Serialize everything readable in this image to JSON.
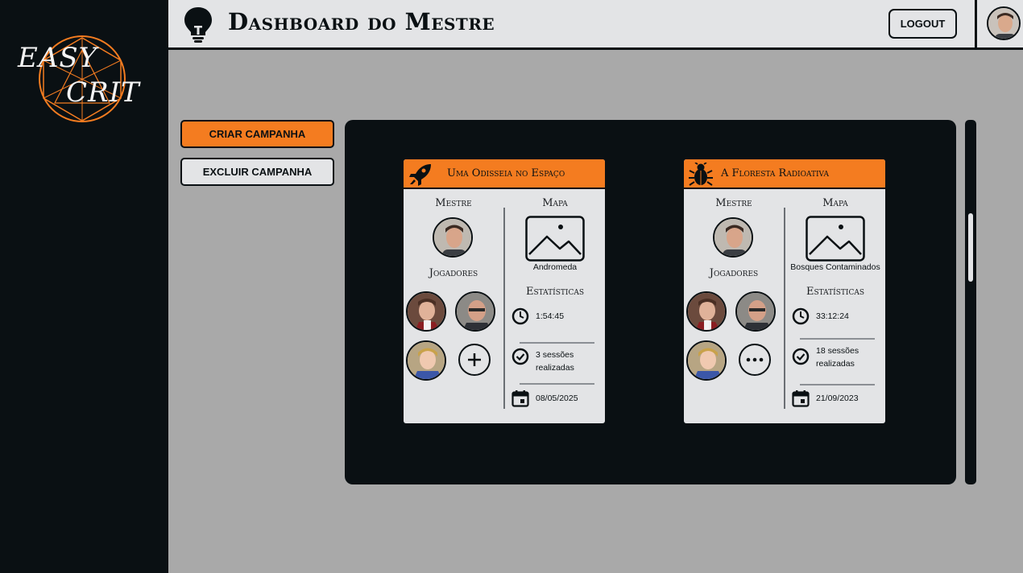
{
  "app": {
    "logo_line1": "EASY",
    "logo_line2": "CRIT",
    "title": "Dashboard do Mestre",
    "logout_label": "LOGOUT"
  },
  "actions": {
    "create_label": "CRIAR CAMPANHA",
    "delete_label": "EXCLUIR CAMPANHA"
  },
  "colors": {
    "accent": "#f47c20",
    "dark": "#0a1013",
    "card_bg": "#e3e4e6",
    "page_bg": "#a9a9a9"
  },
  "campaigns": [
    {
      "icon": "rocket-icon",
      "title": "Uma Odisseia no Espaço",
      "master_label": "Mestre",
      "players_label": "Jogadores",
      "map_label": "Mapa",
      "map_name": "Andromeda",
      "stats_label": "Estatísticas",
      "play_time": "1:54:45",
      "sessions_line1": "3 sessões",
      "sessions_line2": "realizadas",
      "date": "08/05/2025",
      "extra_button": "add-player-button"
    },
    {
      "icon": "bug-icon",
      "title": "A Floresta Radioativa",
      "master_label": "Mestre",
      "players_label": "Jogadores",
      "map_label": "Mapa",
      "map_name": "Bosques Contaminados",
      "stats_label": "Estatísticas",
      "play_time": "33:12:24",
      "sessions_line1": "18 sessões",
      "sessions_line2": "realizadas",
      "date": "21/09/2023",
      "extra_button": "more-players-button"
    }
  ]
}
